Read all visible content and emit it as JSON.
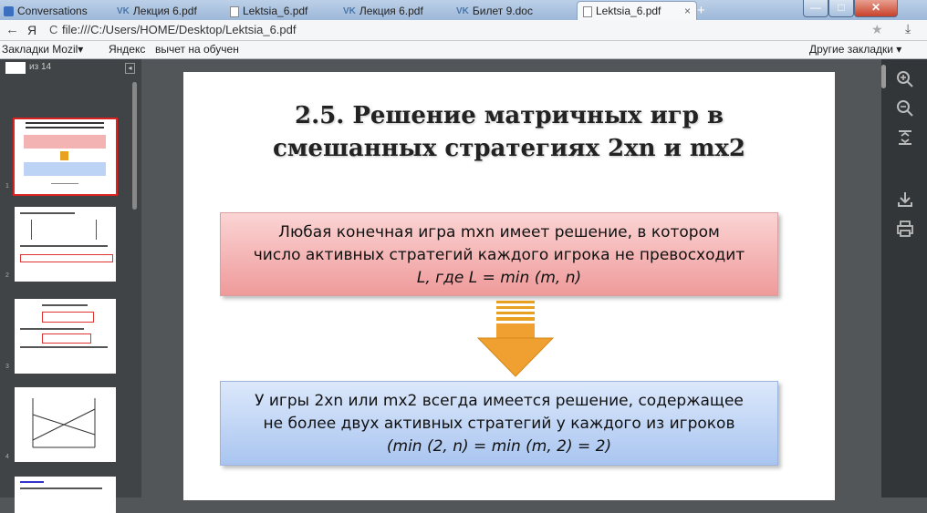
{
  "tabs": [
    {
      "label": "Conversations",
      "icon": "conversations-icon"
    },
    {
      "label": "Лекция 6.pdf",
      "icon": "vk-icon"
    },
    {
      "label": "Lektsia_6.pdf",
      "icon": "document-icon"
    },
    {
      "label": "Лекция 6.pdf",
      "icon": "vk-icon"
    },
    {
      "label": "Билет 9.doc",
      "icon": "vk-icon"
    },
    {
      "label": "Lektsia_6.pdf",
      "icon": "document-icon",
      "active": true
    }
  ],
  "new_tab_label": "+",
  "address": {
    "url": "file:///C:/Users/HOME/Desktop/Lektsia_6.pdf",
    "back_glyph": "←",
    "logo_glyph": "Я",
    "reload_glyph": "C"
  },
  "bookmarks": {
    "items": [
      "Закладки Mozil▾",
      "Яндекс",
      "вычет на обучен"
    ],
    "other": "Другие закладки ▾"
  },
  "pdf": {
    "page_input": "",
    "page_count": "из 14",
    "thumb_numbers": [
      "1",
      "2",
      "3",
      "4"
    ],
    "title_line1": "2.5. Решение матричных игр в",
    "title_line2": "смешанных стратегиях 2xn и mx2",
    "red_line1": "Любая конечная игра mxn имеет решение, в котором",
    "red_line2": "число активных стратегий каждого игрока не превосходит",
    "red_line3": "L, где L = min (m, n)",
    "blue_line1": "У игры 2xn или mx2 всегда имеется решение, содержащее",
    "blue_line2": "не более двух активных стратегий у каждого из игроков",
    "blue_line3": "(min (2, n) = min (m, 2) = 2)"
  },
  "colors": {
    "accent": "#e8a020",
    "red_box": "#f4b3b3",
    "blue_box": "#bcd3f5",
    "viewer_bg": "#525659"
  }
}
